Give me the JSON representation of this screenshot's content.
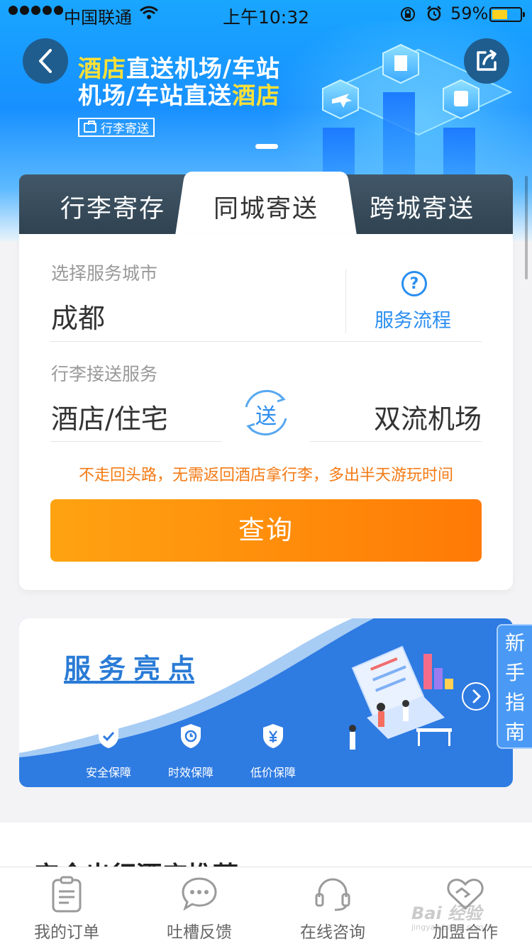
{
  "status_bar": {
    "carrier": "中国联通",
    "time": "上午10:32",
    "battery_percent": "59%",
    "battery_level": 0.59
  },
  "banner": {
    "line1_highlight": "酒店",
    "line1_rest": "直送机场/车站",
    "line2_rest": "机场/车站直送",
    "line2_highlight": "酒店",
    "tag": "行李寄送"
  },
  "tabs": [
    {
      "label": "行李寄存"
    },
    {
      "label": "同城寄送"
    },
    {
      "label": "跨城寄送"
    }
  ],
  "active_tab": 1,
  "form": {
    "city_label": "选择服务城市",
    "city_value": "成都",
    "service_process": "服务流程",
    "luggage_label": "行李接送服务",
    "from_value": "酒店/住宅",
    "swap_text": "送",
    "to_value": "双流机场",
    "promo": "不走回头路，无需返回酒店拿行李，多出半天游玩时间",
    "query_button": "查询"
  },
  "highlights": {
    "title": "服务亮点",
    "badges": [
      {
        "label": "安全保障",
        "icon": "shield-check-icon"
      },
      {
        "label": "时效保障",
        "icon": "shield-clock-icon"
      },
      {
        "label": "低价保障",
        "icon": "shield-yen-icon"
      }
    ]
  },
  "side_guide": {
    "chars": [
      "新",
      "手",
      "指",
      "南"
    ]
  },
  "recommend": {
    "title": "安全出行酒店推荐"
  },
  "bottom_nav": [
    {
      "label": "我的订单",
      "icon": "order-icon"
    },
    {
      "label": "吐槽反馈",
      "icon": "chat-bubble-icon"
    },
    {
      "label": "在线咨询",
      "icon": "headset-icon"
    },
    {
      "label": "加盟合作",
      "icon": "handshake-icon"
    }
  ],
  "watermark": {
    "text": "Bai 经验",
    "sub": "jingyan.baidu.com"
  },
  "colors": {
    "brand_blue": "#1890ff",
    "accent_orange": "#ff7a06",
    "link_blue": "#2a8ef0",
    "highlight_yellow": "#ffe135"
  }
}
